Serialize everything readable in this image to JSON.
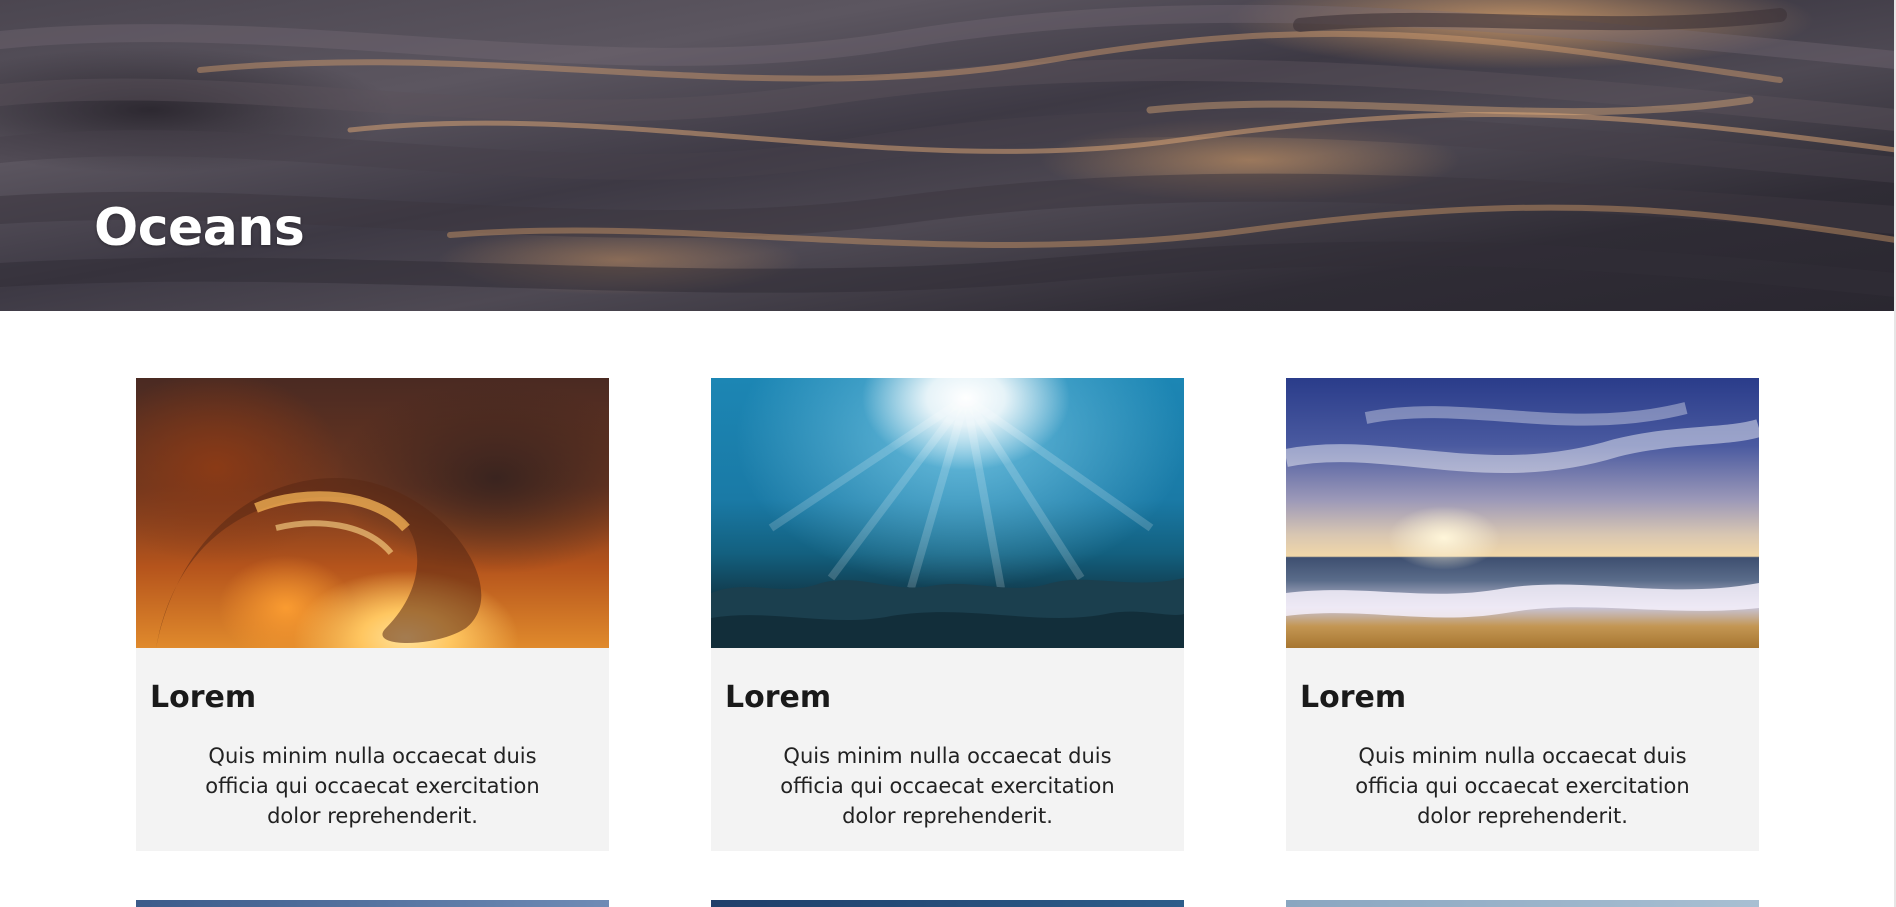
{
  "hero": {
    "title": "Oceans"
  },
  "cards": [
    {
      "title": "Lorem",
      "text": "Quis minim nulla occaecat duis officia qui occaecat exercitation dolor reprehenderit.",
      "image": "ocean-wave-tube-sunset"
    },
    {
      "title": "Lorem",
      "text": "Quis minim nulla occaecat duis officia qui occaecat exercitation dolor reprehenderit.",
      "image": "underwater-sun-rays-reef"
    },
    {
      "title": "Lorem",
      "text": "Quis minim nulla occaecat duis officia qui occaecat exercitation dolor reprehenderit.",
      "image": "beach-sunset-waves"
    }
  ],
  "colors": {
    "card_background": "#f3f3f3",
    "page_background": "#ffffff",
    "hero_title": "#ffffff"
  }
}
